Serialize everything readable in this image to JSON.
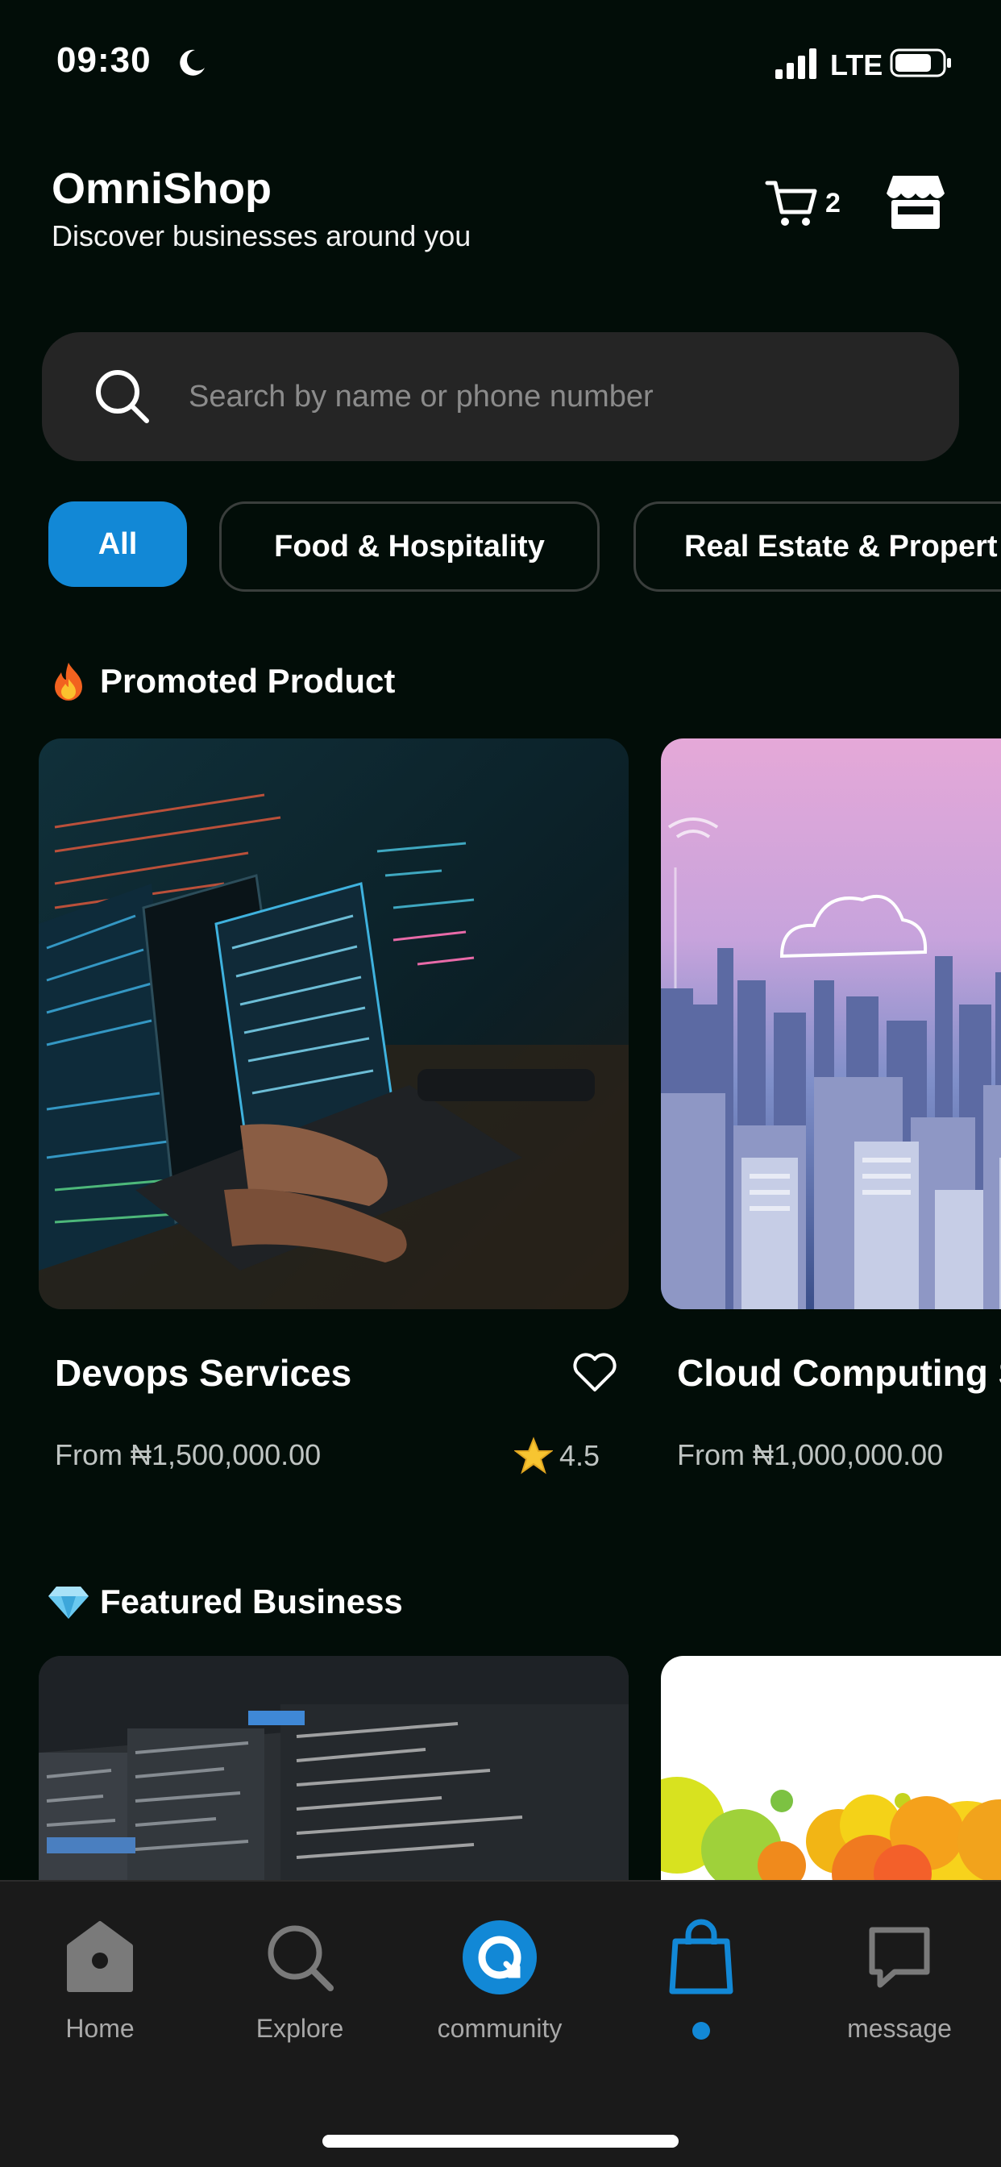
{
  "status_bar": {
    "time": "09:30",
    "network": "LTE"
  },
  "header": {
    "title": "OmniShop",
    "subtitle": "Discover businesses around you",
    "cart_count": "2"
  },
  "search": {
    "placeholder": "Search by name or phone number"
  },
  "categories": [
    {
      "label": "All",
      "selected": true
    },
    {
      "label": "Food & Hospitality",
      "selected": false
    },
    {
      "label": "Real Estate & Propert",
      "selected": false
    }
  ],
  "promoted": {
    "heading": "Promoted Product",
    "icon": "fire-icon",
    "products": [
      {
        "title": "Devops Services",
        "price": "From ₦1,500,000.00",
        "rating": "4.5"
      },
      {
        "title": "Cloud Computing S",
        "price": "From ₦1,000,000.00"
      }
    ]
  },
  "featured": {
    "heading": "Featured Business",
    "icon": "diamond-icon"
  },
  "bottom_nav": [
    {
      "label": "Home",
      "icon": "home-icon"
    },
    {
      "label": "Explore",
      "icon": "search-icon"
    },
    {
      "label": "community",
      "icon": "community-icon"
    },
    {
      "label": "",
      "icon": "shopping-bag-icon",
      "active": true
    },
    {
      "label": "message",
      "icon": "message-icon"
    }
  ],
  "colors": {
    "background": "#020d08",
    "accent": "#1288d6",
    "surface": "#252525",
    "nav_background": "#1a1a1a"
  }
}
